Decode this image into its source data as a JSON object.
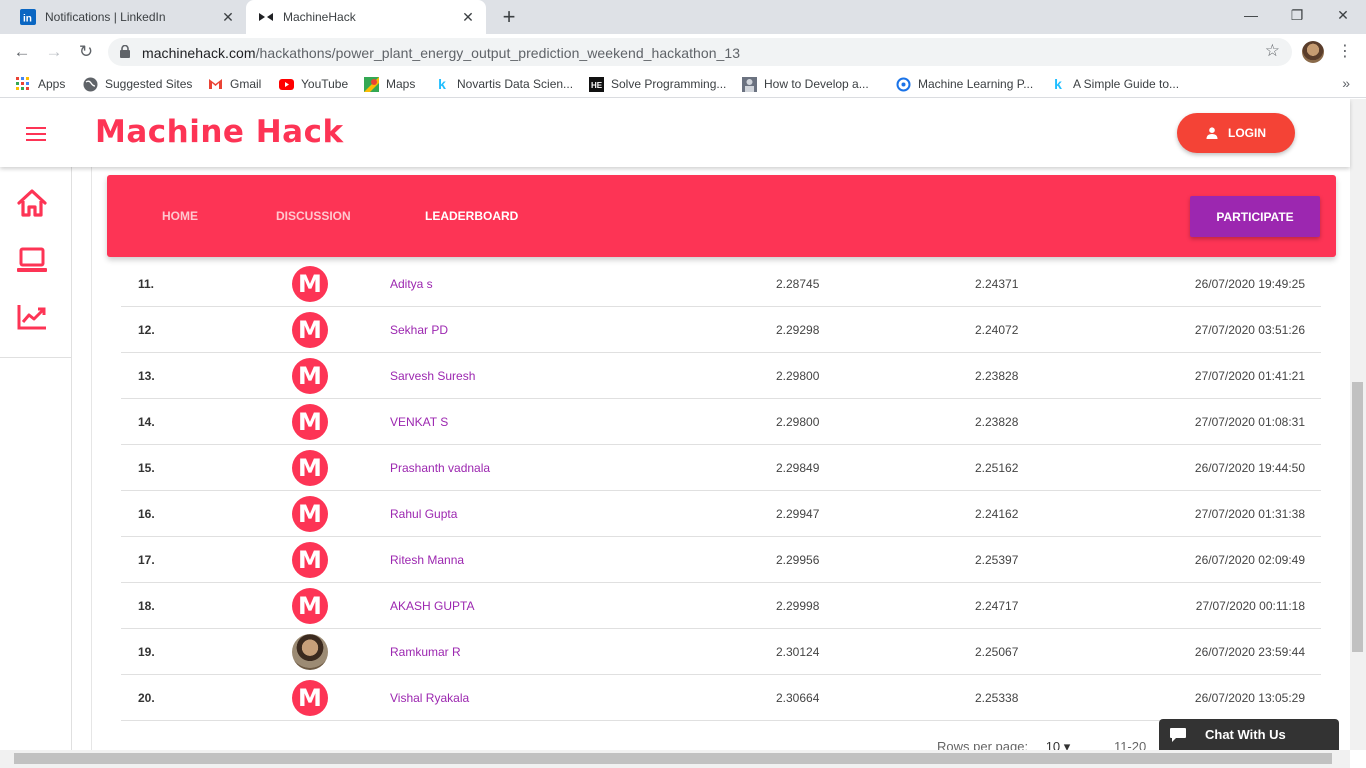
{
  "browser": {
    "tabs": [
      {
        "title": "Notifications | LinkedIn",
        "active": false
      },
      {
        "title": "MachineHack",
        "active": true
      }
    ],
    "url_host": "machinehack.com",
    "url_path": "/hackathons/power_plant_energy_output_prediction_weekend_hackathon_13",
    "bookmarks": [
      {
        "label": "Apps",
        "icon": "apps-grid-icon"
      },
      {
        "label": "Suggested Sites",
        "icon": "globe-icon"
      },
      {
        "label": "Gmail",
        "icon": "gmail-icon"
      },
      {
        "label": "YouTube",
        "icon": "youtube-icon"
      },
      {
        "label": "Maps",
        "icon": "maps-icon"
      },
      {
        "label": "Novartis Data Scien...",
        "icon": "k-icon"
      },
      {
        "label": "Solve Programming...",
        "icon": "hackerearth-icon"
      },
      {
        "label": "How to Develop a...",
        "icon": "page-thumb-icon"
      },
      {
        "label": "Machine Learning P...",
        "icon": "ml-icon"
      },
      {
        "label": "A Simple Guide to...",
        "icon": "k-icon"
      }
    ]
  },
  "header": {
    "logo": "Machine Hack",
    "login_label": "LOGIN"
  },
  "nav": {
    "items": [
      "HOME",
      "DISCUSSION",
      "LEADERBOARD"
    ],
    "active": "LEADERBOARD",
    "participate_label": "PARTICIPATE"
  },
  "leaderboard": {
    "rows": [
      {
        "rank": "11.",
        "name": "Aditya s",
        "score1": "2.28745",
        "score2": "2.24371",
        "date": "26/07/2020 19:49:25",
        "avatar": "M"
      },
      {
        "rank": "12.",
        "name": "Sekhar PD",
        "score1": "2.29298",
        "score2": "2.24072",
        "date": "27/07/2020 03:51:26",
        "avatar": "M"
      },
      {
        "rank": "13.",
        "name": "Sarvesh Suresh",
        "score1": "2.29800",
        "score2": "2.23828",
        "date": "27/07/2020 01:41:21",
        "avatar": "M"
      },
      {
        "rank": "14.",
        "name": "VENKAT S",
        "score1": "2.29800",
        "score2": "2.23828",
        "date": "27/07/2020 01:08:31",
        "avatar": "M"
      },
      {
        "rank": "15.",
        "name": "Prashanth vadnala",
        "score1": "2.29849",
        "score2": "2.25162",
        "date": "26/07/2020 19:44:50",
        "avatar": "M"
      },
      {
        "rank": "16.",
        "name": "Rahul Gupta",
        "score1": "2.29947",
        "score2": "2.24162",
        "date": "27/07/2020 01:31:38",
        "avatar": "M"
      },
      {
        "rank": "17.",
        "name": "Ritesh Manna",
        "score1": "2.29956",
        "score2": "2.25397",
        "date": "26/07/2020 02:09:49",
        "avatar": "M"
      },
      {
        "rank": "18.",
        "name": "AKASH GUPTA",
        "score1": "2.29998",
        "score2": "2.24717",
        "date": "27/07/2020 00:11:18",
        "avatar": "M"
      },
      {
        "rank": "19.",
        "name": "Ramkumar R",
        "score1": "2.30124",
        "score2": "2.25067",
        "date": "26/07/2020 23:59:44",
        "avatar": "photo"
      },
      {
        "rank": "20.",
        "name": "Vishal Ryakala",
        "score1": "2.30664",
        "score2": "2.25338",
        "date": "26/07/2020 13:05:29",
        "avatar": "M"
      }
    ]
  },
  "pagination": {
    "rows_per_page_label": "Rows per page:",
    "rows_per_page_value": "10",
    "range": "11-20"
  },
  "chat": {
    "label": "Chat With Us"
  },
  "colors": {
    "brand": "#fd3455",
    "accent": "#9c27b0",
    "login": "#f44336"
  }
}
